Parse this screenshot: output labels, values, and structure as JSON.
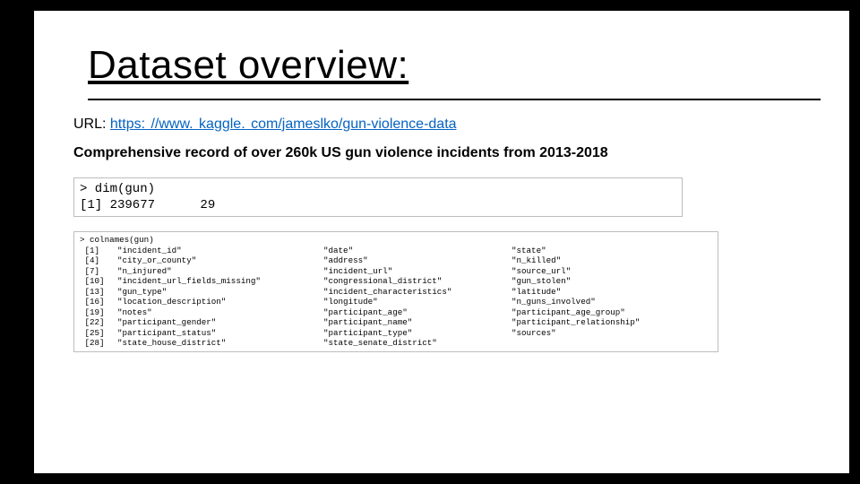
{
  "title": "Dataset overview:",
  "url_label": "URL: ",
  "url_text": "https: //www. kaggle. com/jameslko/gun-violence-data",
  "url_href": "https://www.kaggle.com/jameslko/gun-violence-data",
  "description": "Comprehensive record of over 260k US gun violence incidents from 2013-2018",
  "dim_box": {
    "cmd": "> dim(gun)",
    "out": "[1] 239677      29"
  },
  "names_box": {
    "cmd": "> colnames(gun)",
    "rows": [
      {
        "idx": "[1]",
        "c1": "\"incident_id\"",
        "c2": "\"date\"",
        "c3": "\"state\""
      },
      {
        "idx": "[4]",
        "c1": "\"city_or_county\"",
        "c2": "\"address\"",
        "c3": "\"n_killed\""
      },
      {
        "idx": "[7]",
        "c1": "\"n_injured\"",
        "c2": "\"incident_url\"",
        "c3": "\"source_url\""
      },
      {
        "idx": "[10]",
        "c1": "\"incident_url_fields_missing\"",
        "c2": "\"congressional_district\"",
        "c3": "\"gun_stolen\""
      },
      {
        "idx": "[13]",
        "c1": "\"gun_type\"",
        "c2": "\"incident_characteristics\"",
        "c3": "\"latitude\""
      },
      {
        "idx": "[16]",
        "c1": "\"location_description\"",
        "c2": "\"longitude\"",
        "c3": "\"n_guns_involved\""
      },
      {
        "idx": "[19]",
        "c1": "\"notes\"",
        "c2": "\"participant_age\"",
        "c3": "\"participant_age_group\""
      },
      {
        "idx": "[22]",
        "c1": "\"participant_gender\"",
        "c2": "\"participant_name\"",
        "c3": "\"participant_relationship\""
      },
      {
        "idx": "[25]",
        "c1": "\"participant_status\"",
        "c2": "\"participant_type\"",
        "c3": "\"sources\""
      },
      {
        "idx": "[28]",
        "c1": "\"state_house_district\"",
        "c2": "\"state_senate_district\"",
        "c3": ""
      }
    ]
  }
}
